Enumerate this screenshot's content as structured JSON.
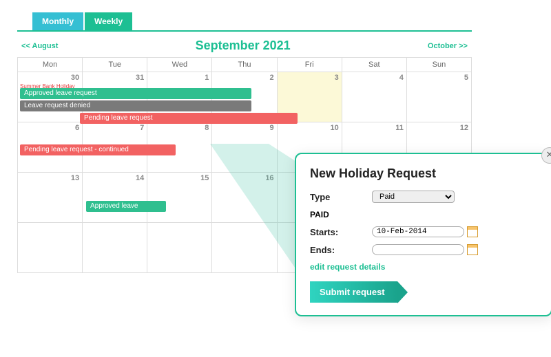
{
  "tabs": {
    "monthly": "Monthly",
    "weekly": "Weekly"
  },
  "nav": {
    "prev": "<< August",
    "title": "September 2021",
    "next": "October >>"
  },
  "dow": [
    "Mon",
    "Tue",
    "Wed",
    "Thu",
    "Fri",
    "Sat",
    "Sun"
  ],
  "weeks": [
    [
      "30",
      "31",
      "1",
      "2",
      "3",
      "4",
      "5"
    ],
    [
      "6",
      "7",
      "8",
      "9",
      "10",
      "11",
      "12"
    ],
    [
      "13",
      "14",
      "15",
      "16",
      "",
      "",
      ""
    ],
    [
      "",
      "",
      "",
      "",
      "",
      "",
      ""
    ]
  ],
  "holiday_label": "Summer Bank Holiday",
  "events": {
    "approved1": "Approved leave request",
    "denied": "Leave request denied",
    "pending1": "Pending leave request",
    "pending2": "Pending leave request - continued",
    "approved2": "Approved leave"
  },
  "dialog": {
    "title": "New Holiday Request",
    "type_label": "Type",
    "type_value": "Paid",
    "section": "PAID",
    "starts_label": "Starts:",
    "starts_value": "10-Feb-2014",
    "ends_label": "Ends:",
    "ends_value": "",
    "edit_link": "edit request details",
    "submit": "Submit request"
  }
}
